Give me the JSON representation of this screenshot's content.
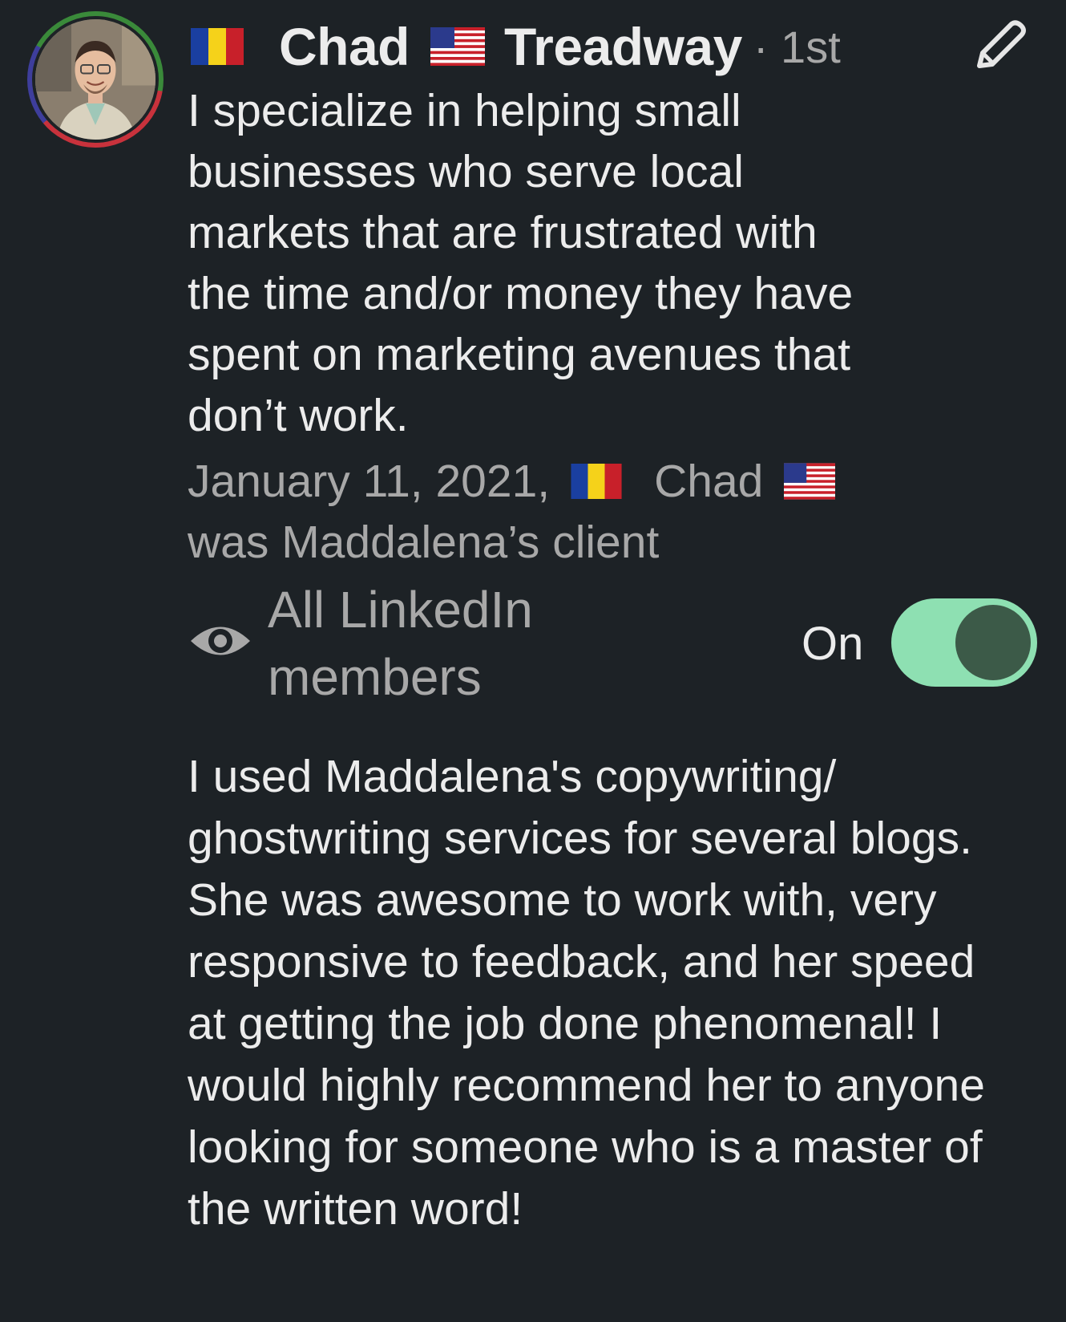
{
  "recommender": {
    "name_first": "Chad",
    "name_last": "Treadway",
    "degree": "· 1st",
    "flag_before_name": "romania-flag-icon",
    "flag_between_names": "us-flag-icon",
    "headline": "I specialize in helping small businesses who serve local markets that are frustrated with the time and/or money they have spent on marketing avenues that don’t work."
  },
  "edit_icon": "pencil-icon",
  "meta": {
    "date": "January 11, 2021,",
    "name": "Chad",
    "relation": "was Maddalena’s client"
  },
  "visibility": {
    "icon": "eye-icon",
    "label": "All LinkedIn members",
    "status": "On",
    "enabled": true,
    "toggle_color": "#8ee0b2"
  },
  "recommendation_text": "I used Maddalena's copywriting/ ghostwriting services for several blogs. She was awesome to work with, very responsive to feedback, and her speed at getting the job done phenomenal! I would highly recommend her to anyone looking for someone who is a master of the written word!"
}
